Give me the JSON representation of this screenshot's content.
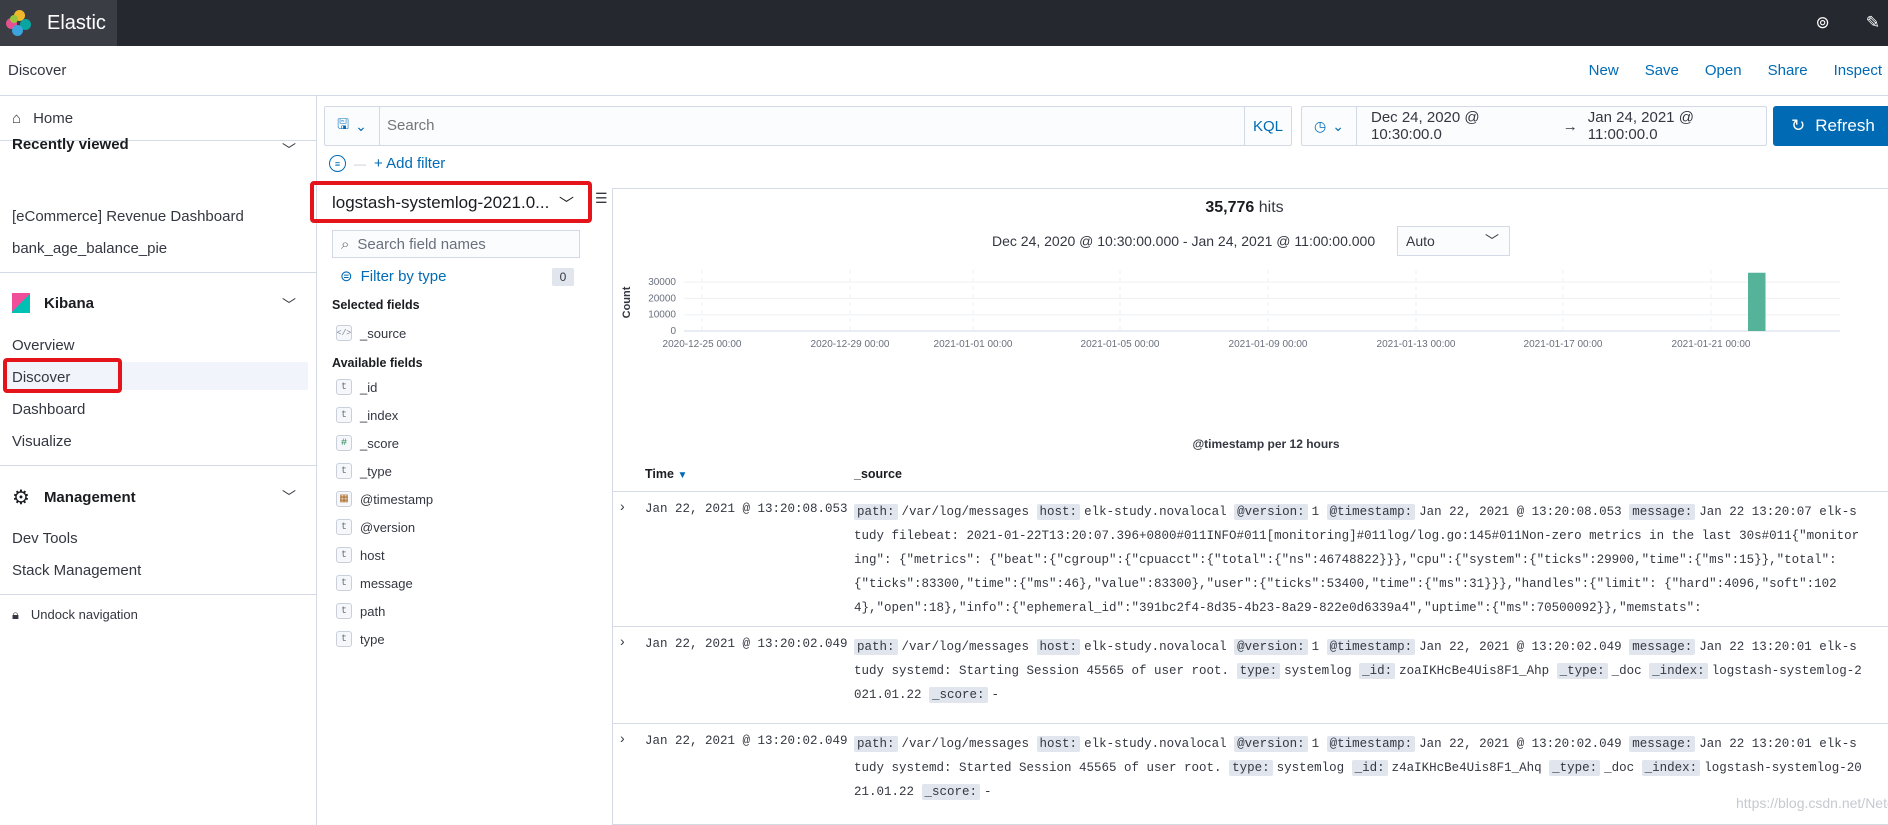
{
  "app": {
    "title": "Elastic"
  },
  "breadcrumb": "Discover",
  "top_actions": [
    "New",
    "Save",
    "Open",
    "Share",
    "Inspect"
  ],
  "nav": {
    "home": "Home",
    "recently_viewed": {
      "title": "Recently viewed",
      "items": [
        "[eCommerce] Revenue Dashboard",
        "bank_age_balance_pie"
      ]
    },
    "kibana": {
      "title": "Kibana",
      "items": [
        "Overview",
        "Discover",
        "Dashboard",
        "Visualize"
      ]
    },
    "management": {
      "title": "Management",
      "items": [
        "Dev Tools",
        "Stack Management"
      ]
    },
    "undock": "Undock navigation"
  },
  "query": {
    "placeholder": "Search",
    "language": "KQL",
    "add_filter": "+ Add filter"
  },
  "date": {
    "start": "Dec 24, 2020 @ 10:30:00.0",
    "arrow": "→",
    "end": "Jan 24, 2021 @ 11:00:00.0",
    "refresh": "Refresh"
  },
  "index_pattern": "logstash-systemlog-2021.0...",
  "field_search_placeholder": "Search field names",
  "filter_by_type": {
    "label": "Filter by type",
    "count": "0"
  },
  "selected_fields": {
    "title": "Selected fields",
    "items": [
      {
        "type": "source",
        "name": "_source"
      }
    ]
  },
  "available_fields": {
    "title": "Available fields",
    "items": [
      {
        "type": "t",
        "name": "_id"
      },
      {
        "type": "t",
        "name": "_index"
      },
      {
        "type": "#",
        "name": "_score"
      },
      {
        "type": "t",
        "name": "_type"
      },
      {
        "type": "date",
        "name": "@timestamp"
      },
      {
        "type": "t",
        "name": "@version"
      },
      {
        "type": "t",
        "name": "host"
      },
      {
        "type": "t",
        "name": "message"
      },
      {
        "type": "t",
        "name": "path"
      },
      {
        "type": "t",
        "name": "type"
      }
    ]
  },
  "hits": {
    "count": "35,776",
    "label": "hits"
  },
  "time_range": "Dec 24, 2020 @ 10:30:00.000 - Jan 24, 2021 @ 11:00:00.000",
  "interval": "Auto",
  "chart_data": {
    "type": "bar",
    "title": "",
    "xlabel": "@timestamp per 12 hours",
    "ylabel": "Count",
    "ylim": [
      0,
      35000
    ],
    "yticks": [
      0,
      10000,
      20000,
      30000
    ],
    "xticks": [
      "2020-12-25 00:00",
      "2020-12-29 00:00",
      "2021-01-01 00:00",
      "2021-01-05 00:00",
      "2021-01-09 00:00",
      "2021-01-13 00:00",
      "2021-01-17 00:00",
      "2021-01-21 00:00"
    ],
    "bars": [
      {
        "x": "2021-01-22 00:00",
        "value": 35776
      }
    ],
    "color": "#54b399",
    "grid": true
  },
  "table": {
    "headers": [
      "Time",
      "_source"
    ],
    "rows": [
      {
        "time": "Jan 22, 2021 @ 13:20:08.053",
        "pairs": [
          [
            "path:",
            "/var/log/messages"
          ],
          [
            "host:",
            "elk-study.novalocal"
          ],
          [
            "@version:",
            "1"
          ],
          [
            "@timestamp:",
            "Jan 22, 2021 @ 13:20:08.053"
          ],
          [
            "message:",
            "Jan 22 13:20:07 elk-study filebeat: 2021-01-22T13:20:07.396+0800#011INFO#011[monitoring]#011log/log.go:145#011Non-zero metrics in the last 30s#011{\"monitoring\": {\"metrics\": {\"beat\":{\"cgroup\":{\"cpuacct\":{\"total\":{\"ns\":46748822}}},\"cpu\":{\"system\":{\"ticks\":29900,\"time\":{\"ms\":15}},\"total\": {\"ticks\":83300,\"time\":{\"ms\":46},\"value\":83300},\"user\":{\"ticks\":53400,\"time\":{\"ms\":31}}},\"handles\":{\"limit\": {\"hard\":4096,\"soft\":1024},\"open\":18},\"info\":{\"ephemeral_id\":\"391bc2f4-8d35-4b23-8a29-822e0d6339a4\",\"uptime\":{\"ms\":70500092}},\"memstats\":"
          ]
        ]
      },
      {
        "time": "Jan 22, 2021 @ 13:20:02.049",
        "pairs": [
          [
            "path:",
            "/var/log/messages"
          ],
          [
            "host:",
            "elk-study.novalocal"
          ],
          [
            "@version:",
            "1"
          ],
          [
            "@timestamp:",
            "Jan 22, 2021 @ 13:20:02.049"
          ],
          [
            "message:",
            "Jan 22 13:20:01 elk-study systemd: Starting Session 45565 of user root."
          ],
          [
            "type:",
            "systemlog"
          ],
          [
            "_id:",
            "zoaIKHcBe4Uis8F1_Ahp"
          ],
          [
            "_type:",
            "_doc"
          ],
          [
            "_index:",
            "logstash-systemlog-2021.01.22"
          ],
          [
            "_score:",
            "-"
          ]
        ]
      },
      {
        "time": "Jan 22, 2021 @ 13:20:02.049",
        "pairs": [
          [
            "path:",
            "/var/log/messages"
          ],
          [
            "host:",
            "elk-study.novalocal"
          ],
          [
            "@version:",
            "1"
          ],
          [
            "@timestamp:",
            "Jan 22, 2021 @ 13:20:02.049"
          ],
          [
            "message:",
            "Jan 22 13:20:01 elk-study systemd: Started Session 45565 of user root."
          ],
          [
            "type:",
            "systemlog"
          ],
          [
            "_id:",
            "z4aIKHcBe4Uis8F1_Ahq"
          ],
          [
            "_type:",
            "_doc"
          ],
          [
            "_index:",
            "logstash-systemlog-2021.01.22"
          ],
          [
            "_score:",
            "-"
          ]
        ]
      }
    ]
  },
  "watermark": "https://blog.csdn.net/Netceor"
}
